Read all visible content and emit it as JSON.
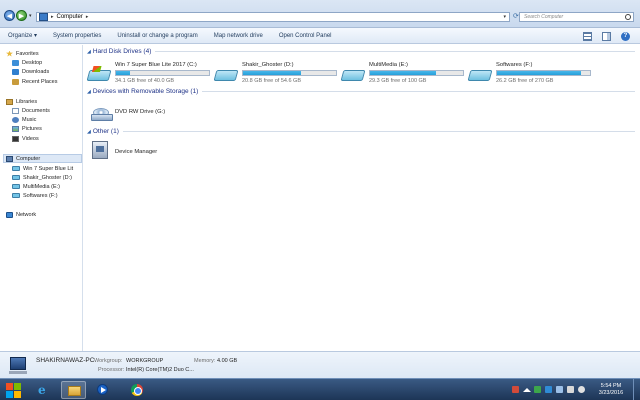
{
  "address": {
    "location": "Computer",
    "search_placeholder": "Search Computer"
  },
  "toolbar": {
    "organize": "Organize ▾",
    "system_properties": "System properties",
    "uninstall": "Uninstall or change a program",
    "map_drive": "Map network drive",
    "control_panel": "Open Control Panel"
  },
  "nav": {
    "favorites": "Favorites",
    "desktop": "Desktop",
    "downloads": "Downloads",
    "recent_places": "Recent Places",
    "libraries": "Libraries",
    "documents": "Documents",
    "music": "Music",
    "pictures": "Pictures",
    "videos": "Videos",
    "computer": "Computer",
    "drive_c": "Win 7 Super Blue Lit",
    "drive_d": "Shakir_Ghoster (D:)",
    "drive_e": "MultiMedia (E:)",
    "drive_f": "Softwares (F:)",
    "network": "Network"
  },
  "groups": {
    "hard_disk": "Hard Disk Drives (4)",
    "removable": "Devices with Removable Storage (1)",
    "other": "Other (1)"
  },
  "drives": [
    {
      "name": "Win 7 Super Blue Lite 2017 (C:)",
      "free": "34.1 GB free of 40.0 GB",
      "used_fraction": 0.15
    },
    {
      "name": "Shakir_Ghoster (D:)",
      "free": "20.8 GB free of 54.6 GB",
      "used_fraction": 0.62
    },
    {
      "name": "MultiMedia (E:)",
      "free": "29.3 GB free of 100 GB",
      "used_fraction": 0.71
    },
    {
      "name": "Softwares (F:)",
      "free": "26.2 GB free of 270 GB",
      "used_fraction": 0.9
    }
  ],
  "removable": {
    "name": "DVD RW Drive (G:)"
  },
  "other": {
    "name": "Device Manager"
  },
  "details": {
    "pc_name": "SHAKIRNAWAZ-PC",
    "workgroup_label": "Workgroup:",
    "workgroup_value": "WORKGROUP",
    "memory_label": "Memory:",
    "memory_value": "4.00 GB",
    "processor_label": "Processor:",
    "processor_value": "Intel(R) Core(TM)2 Duo C..."
  },
  "taskbar": {
    "time": "5:54 PM",
    "date": "3/23/2016"
  },
  "colors": {
    "drive_fill": "#26a0da",
    "taskbar": "#1d3556",
    "group_title": "#1e3287"
  }
}
